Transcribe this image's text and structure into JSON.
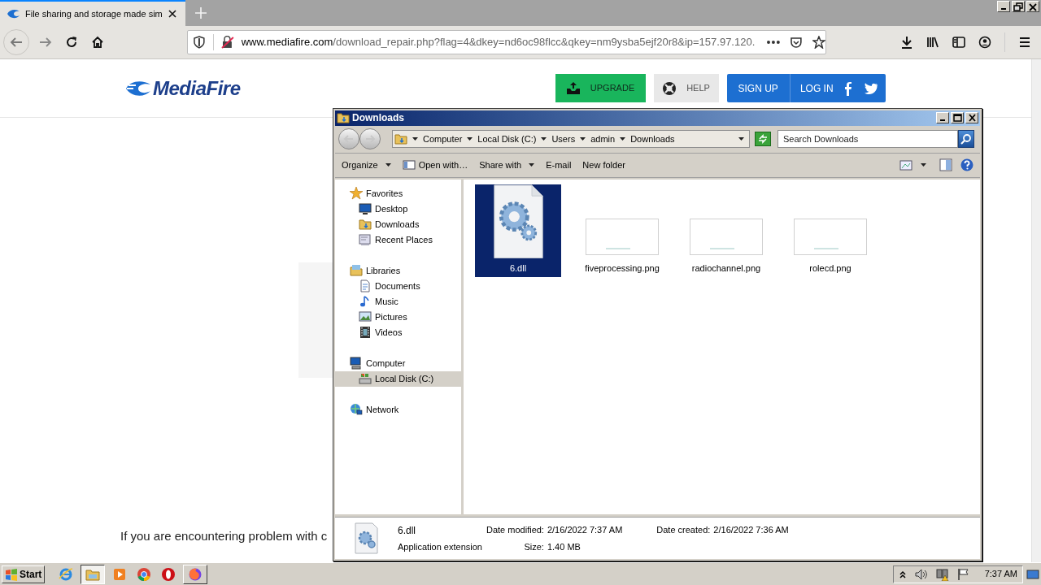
{
  "browser": {
    "tab": {
      "title": "File sharing and storage made sim",
      "selected": true
    },
    "url": {
      "host": "www.mediafire.com",
      "path": "/download_repair.php?flag=4&dkey=nd6oc98flcc&qkey=nm9ysba5ejf20r8&ip=157.97.120."
    }
  },
  "page": {
    "logo": "MediaFire",
    "buttons": [
      {
        "kind": "upgrade",
        "label": "UPGRADE"
      },
      {
        "kind": "help",
        "label": "HELP"
      },
      {
        "kind": "signup",
        "label": "SIGN UP"
      },
      {
        "kind": "login",
        "label": "LOG IN"
      }
    ],
    "message": "If you are encountering problem with c"
  },
  "explorer": {
    "title": "Downloads",
    "breadcrumb": [
      "Computer",
      "Local Disk (C:)",
      "Users",
      "admin",
      "Downloads"
    ],
    "search": {
      "placeholder": "Search Downloads"
    },
    "toolbar": [
      {
        "label": "Organize",
        "dropdown": true,
        "icon": false
      },
      {
        "label": "Open with…",
        "dropdown": false,
        "icon": true
      },
      {
        "label": "Share with",
        "dropdown": true,
        "icon": false
      },
      {
        "label": "E-mail",
        "dropdown": false,
        "icon": false
      },
      {
        "label": "New folder",
        "dropdown": false,
        "icon": false
      }
    ],
    "nav": [
      {
        "label": "Favorites",
        "kind": "star",
        "selected": false,
        "children": [
          {
            "label": "Desktop",
            "kind": "desktop",
            "selected": false
          },
          {
            "label": "Downloads",
            "kind": "folder",
            "selected": false
          },
          {
            "label": "Recent Places",
            "kind": "recent",
            "selected": false
          }
        ]
      },
      {
        "label": "Libraries",
        "kind": "library",
        "selected": false,
        "children": [
          {
            "label": "Documents",
            "kind": "document",
            "selected": false
          },
          {
            "label": "Music",
            "kind": "music",
            "selected": false
          },
          {
            "label": "Pictures",
            "kind": "pictures",
            "selected": false
          },
          {
            "label": "Videos",
            "kind": "videos",
            "selected": false
          }
        ]
      },
      {
        "label": "Computer",
        "kind": "computer",
        "selected": false,
        "children": [
          {
            "label": "Local Disk (C:)",
            "kind": "disk",
            "selected": true
          }
        ]
      },
      {
        "label": "Network",
        "kind": "network",
        "selected": false
      }
    ],
    "files": [
      {
        "name": "6.dll",
        "kind": "dll",
        "selected": true
      },
      {
        "name": "fiveprocessing.png",
        "kind": "png",
        "selected": false
      },
      {
        "name": "radiochannel.png",
        "kind": "png",
        "selected": false
      },
      {
        "name": "rolecd.png",
        "kind": "png",
        "selected": false
      }
    ],
    "details": {
      "name": "6.dll",
      "type": "Application extension",
      "fields": [
        {
          "label": "Date modified:",
          "value": "2/16/2022 7:37 AM"
        },
        {
          "label": "Size:",
          "value": "1.40 MB"
        },
        {
          "label": "Date created:",
          "value": "2/16/2022 7:36 AM"
        }
      ]
    }
  },
  "taskbar": {
    "start": "Start",
    "apps": [
      {
        "kind": "ie",
        "selected": false,
        "open": false
      },
      {
        "kind": "explorer",
        "selected": true,
        "open": true
      },
      {
        "kind": "media",
        "selected": false,
        "open": false
      },
      {
        "kind": "chrome",
        "selected": false,
        "open": false
      },
      {
        "kind": "opera",
        "selected": false,
        "open": false
      },
      {
        "kind": "firefox",
        "selected": false,
        "open": true
      }
    ],
    "clock": "7:37 AM"
  }
}
